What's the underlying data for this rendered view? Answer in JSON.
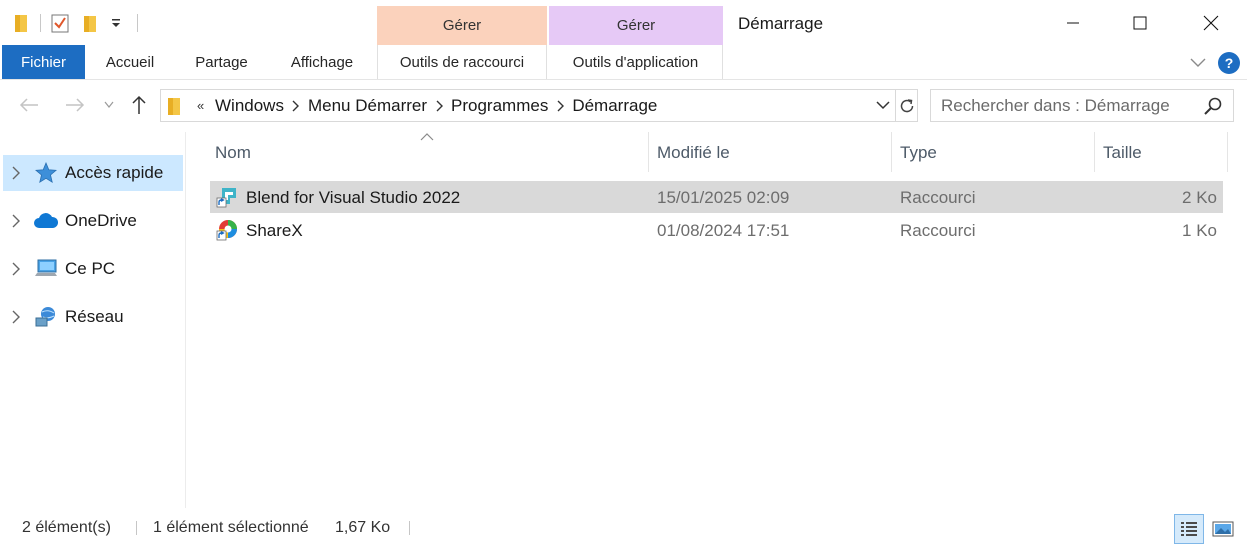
{
  "window": {
    "title": "Démarrage",
    "context_group_shortcut": "Gérer",
    "context_group_application": "Gérer",
    "colors": {
      "shortcut_context": "#fbd2bc",
      "application_context": "#e6c9f6",
      "accent": "#1d6dc2",
      "selection": "#cce8ff"
    }
  },
  "ribbon": {
    "tabs": {
      "file": "Fichier",
      "home": "Accueil",
      "share": "Partage",
      "view": "Affichage",
      "shortcut_tools": "Outils de raccourci",
      "app_tools": "Outils d'application"
    },
    "help": "?"
  },
  "address": {
    "overflow": "«",
    "crumbs": [
      "Windows",
      "Menu Démarrer",
      "Programmes",
      "Démarrage"
    ]
  },
  "search": {
    "placeholder": "Rechercher dans : Démarrage"
  },
  "nav_pane": {
    "items": [
      {
        "label": "Accès rapide",
        "icon": "star-icon"
      },
      {
        "label": "OneDrive",
        "icon": "cloud-icon"
      },
      {
        "label": "Ce PC",
        "icon": "computer-icon"
      },
      {
        "label": "Réseau",
        "icon": "network-icon"
      }
    ]
  },
  "columns": {
    "name": "Nom",
    "modified": "Modifié le",
    "type": "Type",
    "size": "Taille"
  },
  "files": [
    {
      "name": "Blend for Visual Studio 2022",
      "modified": "15/01/2025 02:09",
      "type": "Raccourci",
      "size": "2 Ko",
      "icon": "blend-shortcut-icon"
    },
    {
      "name": "ShareX",
      "modified": "01/08/2024 17:51",
      "type": "Raccourci",
      "size": "1 Ko",
      "icon": "sharex-shortcut-icon"
    }
  ],
  "status": {
    "count": "2 élément(s)",
    "selected": "1 élément sélectionné",
    "selected_size": "1,67 Ko"
  }
}
